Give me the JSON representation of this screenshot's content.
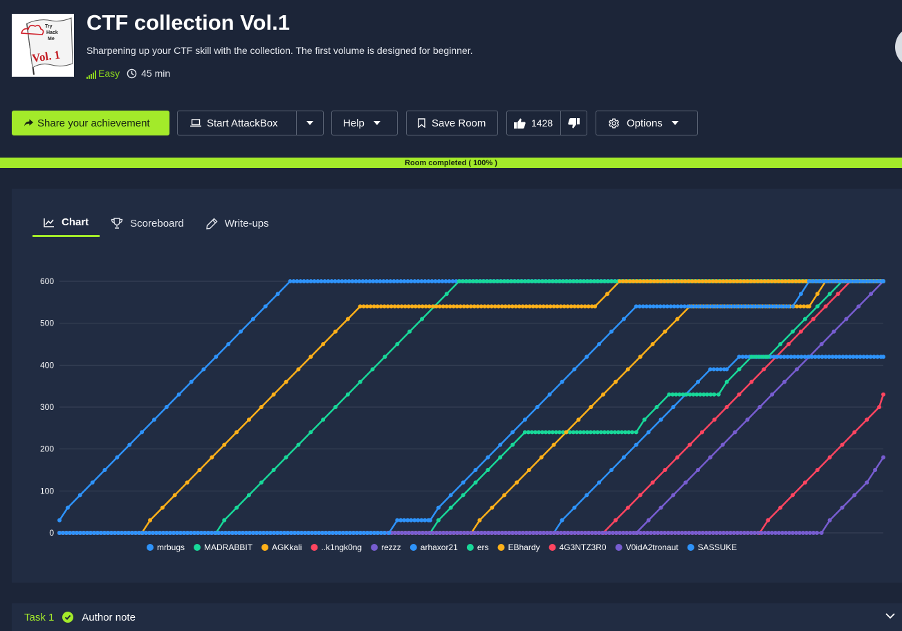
{
  "room": {
    "title": "CTF collection Vol.1",
    "description": "Sharpening up your CTF skill with the collection. The first volume is designed for beginner.",
    "difficulty": "Easy",
    "duration": "45 min",
    "thumbnail": {
      "brand_text_1": "Try",
      "brand_text_2": "Hack",
      "brand_text_3": "Me",
      "vol_text": "Vol. 1"
    }
  },
  "toolbar": {
    "share_label": "Share your achievement",
    "attackbox_label": "Start AttackBox",
    "help_label": "Help",
    "save_label": "Save Room",
    "upvotes": "1428",
    "options_label": "Options"
  },
  "progress": {
    "label": "Room completed ( 100% )",
    "value": 1.0
  },
  "tabs": [
    {
      "label": "Chart",
      "active": true,
      "icon": "chart-line-icon"
    },
    {
      "label": "Scoreboard",
      "active": false,
      "icon": "trophy-icon"
    },
    {
      "label": "Write-ups",
      "active": false,
      "icon": "pencil-icon"
    }
  ],
  "task": {
    "number": "Task 1",
    "title": "Author note"
  },
  "colors": {
    "accent": "#a3ea2a",
    "easy": "#8bd41e",
    "background": "#1c2538",
    "panel": "#212c42"
  },
  "chart_data": {
    "type": "line",
    "title": "",
    "xlabel": "",
    "ylabel": "",
    "ylim": [
      0,
      600
    ],
    "yticks": [
      0,
      100,
      200,
      300,
      400,
      500,
      600
    ],
    "xlim": [
      0,
      200
    ],
    "grid": true,
    "legend_position": "bottom",
    "series": [
      {
        "name": "mrbugs",
        "color": "#2e93fa",
        "points": [
          [
            0,
            30
          ],
          [
            2,
            60
          ],
          [
            5,
            90
          ],
          [
            8,
            120
          ],
          [
            11,
            150
          ],
          [
            14,
            180
          ],
          [
            17,
            210
          ],
          [
            20,
            240
          ],
          [
            23,
            270
          ],
          [
            26,
            300
          ],
          [
            29,
            330
          ],
          [
            32,
            360
          ],
          [
            35,
            390
          ],
          [
            38,
            420
          ],
          [
            41,
            450
          ],
          [
            44,
            480
          ],
          [
            47,
            510
          ],
          [
            50,
            540
          ],
          [
            53,
            570
          ],
          [
            56,
            600
          ],
          [
            200,
            600
          ]
        ]
      },
      {
        "name": "MADRABBIT",
        "color": "#18d899",
        "points": [
          [
            0,
            0
          ],
          [
            38,
            0
          ],
          [
            40,
            30
          ],
          [
            43,
            60
          ],
          [
            46,
            90
          ],
          [
            49,
            120
          ],
          [
            52,
            150
          ],
          [
            55,
            180
          ],
          [
            58,
            210
          ],
          [
            61,
            240
          ],
          [
            64,
            270
          ],
          [
            67,
            300
          ],
          [
            70,
            330
          ],
          [
            73,
            360
          ],
          [
            76,
            390
          ],
          [
            79,
            420
          ],
          [
            82,
            450
          ],
          [
            85,
            480
          ],
          [
            88,
            510
          ],
          [
            91,
            540
          ],
          [
            94,
            570
          ],
          [
            97,
            600
          ],
          [
            200,
            600
          ]
        ]
      },
      {
        "name": "AGKkali",
        "color": "#feb019",
        "points": [
          [
            0,
            0
          ],
          [
            20,
            0
          ],
          [
            22,
            30
          ],
          [
            25,
            60
          ],
          [
            28,
            90
          ],
          [
            31,
            120
          ],
          [
            34,
            150
          ],
          [
            37,
            180
          ],
          [
            40,
            210
          ],
          [
            43,
            240
          ],
          [
            46,
            270
          ],
          [
            49,
            300
          ],
          [
            52,
            330
          ],
          [
            55,
            360
          ],
          [
            58,
            390
          ],
          [
            61,
            420
          ],
          [
            64,
            450
          ],
          [
            67,
            480
          ],
          [
            70,
            510
          ],
          [
            73,
            540
          ],
          [
            130,
            540
          ],
          [
            133,
            570
          ],
          [
            136,
            600
          ],
          [
            200,
            600
          ]
        ]
      },
      {
        "name": "..k1ngk0ng",
        "color": "#ff4560",
        "points": [
          [
            0,
            0
          ],
          [
            132,
            0
          ],
          [
            135,
            30
          ],
          [
            138,
            60
          ],
          [
            141,
            90
          ],
          [
            144,
            120
          ],
          [
            147,
            150
          ],
          [
            150,
            180
          ],
          [
            153,
            210
          ],
          [
            156,
            240
          ],
          [
            159,
            270
          ],
          [
            162,
            300
          ],
          [
            165,
            330
          ],
          [
            168,
            360
          ],
          [
            171,
            390
          ],
          [
            174,
            420
          ],
          [
            177,
            450
          ],
          [
            180,
            480
          ],
          [
            183,
            510
          ],
          [
            186,
            540
          ],
          [
            189,
            570
          ],
          [
            192,
            600
          ],
          [
            200,
            600
          ]
        ]
      },
      {
        "name": "rezzz",
        "color": "#775dd0",
        "points": [
          [
            0,
            0
          ],
          [
            140,
            0
          ],
          [
            143,
            30
          ],
          [
            146,
            60
          ],
          [
            149,
            90
          ],
          [
            152,
            120
          ],
          [
            155,
            150
          ],
          [
            158,
            180
          ],
          [
            161,
            210
          ],
          [
            164,
            240
          ],
          [
            167,
            270
          ],
          [
            170,
            300
          ],
          [
            173,
            330
          ],
          [
            176,
            360
          ],
          [
            179,
            390
          ],
          [
            182,
            420
          ],
          [
            185,
            450
          ],
          [
            188,
            480
          ],
          [
            191,
            510
          ],
          [
            194,
            540
          ],
          [
            197,
            570
          ],
          [
            200,
            600
          ]
        ]
      },
      {
        "name": "arhaxor21",
        "color": "#2e93fa",
        "points": [
          [
            0,
            0
          ],
          [
            120,
            0
          ],
          [
            122,
            30
          ],
          [
            125,
            60
          ],
          [
            128,
            90
          ],
          [
            131,
            120
          ],
          [
            134,
            150
          ],
          [
            137,
            180
          ],
          [
            140,
            210
          ],
          [
            143,
            240
          ],
          [
            146,
            270
          ],
          [
            149,
            300
          ],
          [
            152,
            330
          ],
          [
            155,
            360
          ],
          [
            158,
            390
          ],
          [
            162,
            390
          ],
          [
            165,
            420
          ],
          [
            200,
            420
          ]
        ]
      },
      {
        "name": "ers",
        "color": "#18d899",
        "points": [
          [
            0,
            0
          ],
          [
            90,
            0
          ],
          [
            92,
            30
          ],
          [
            95,
            60
          ],
          [
            98,
            90
          ],
          [
            101,
            120
          ],
          [
            104,
            150
          ],
          [
            107,
            180
          ],
          [
            110,
            210
          ],
          [
            113,
            240
          ],
          [
            140,
            240
          ],
          [
            142,
            270
          ],
          [
            145,
            300
          ],
          [
            148,
            330
          ],
          [
            160,
            330
          ],
          [
            162,
            360
          ],
          [
            165,
            390
          ],
          [
            168,
            420
          ],
          [
            172,
            420
          ],
          [
            175,
            450
          ],
          [
            178,
            480
          ],
          [
            181,
            510
          ],
          [
            184,
            540
          ],
          [
            187,
            570
          ],
          [
            190,
            600
          ],
          [
            200,
            600
          ]
        ]
      },
      {
        "name": "EBhardy",
        "color": "#feb019",
        "points": [
          [
            0,
            0
          ],
          [
            100,
            0
          ],
          [
            102,
            30
          ],
          [
            105,
            60
          ],
          [
            108,
            90
          ],
          [
            111,
            120
          ],
          [
            114,
            150
          ],
          [
            117,
            180
          ],
          [
            120,
            210
          ],
          [
            123,
            240
          ],
          [
            126,
            270
          ],
          [
            129,
            300
          ],
          [
            132,
            330
          ],
          [
            135,
            360
          ],
          [
            138,
            390
          ],
          [
            141,
            420
          ],
          [
            144,
            450
          ],
          [
            147,
            480
          ],
          [
            150,
            510
          ],
          [
            153,
            540
          ],
          [
            182,
            540
          ],
          [
            184,
            570
          ],
          [
            186,
            600
          ],
          [
            200,
            600
          ]
        ]
      },
      {
        "name": "4G3NTZ3R0",
        "color": "#ff4560",
        "points": [
          [
            0,
            0
          ],
          [
            170,
            0
          ],
          [
            172,
            30
          ],
          [
            175,
            60
          ],
          [
            178,
            90
          ],
          [
            181,
            120
          ],
          [
            184,
            150
          ],
          [
            187,
            180
          ],
          [
            190,
            210
          ],
          [
            193,
            240
          ],
          [
            196,
            270
          ],
          [
            199,
            300
          ],
          [
            200,
            330
          ]
        ]
      },
      {
        "name": "V0idA2tronaut",
        "color": "#775dd0",
        "points": [
          [
            0,
            0
          ],
          [
            185,
            0
          ],
          [
            187,
            30
          ],
          [
            190,
            60
          ],
          [
            193,
            90
          ],
          [
            196,
            120
          ],
          [
            198,
            150
          ],
          [
            200,
            180
          ]
        ]
      },
      {
        "name": "SASSUKE",
        "color": "#2e93fa",
        "points": [
          [
            0,
            0
          ],
          [
            80,
            0
          ],
          [
            82,
            30
          ],
          [
            90,
            30
          ],
          [
            92,
            60
          ],
          [
            95,
            90
          ],
          [
            98,
            120
          ],
          [
            101,
            150
          ],
          [
            104,
            180
          ],
          [
            107,
            210
          ],
          [
            110,
            240
          ],
          [
            113,
            270
          ],
          [
            116,
            300
          ],
          [
            119,
            330
          ],
          [
            122,
            360
          ],
          [
            125,
            390
          ],
          [
            128,
            420
          ],
          [
            131,
            450
          ],
          [
            134,
            480
          ],
          [
            137,
            510
          ],
          [
            140,
            540
          ],
          [
            178,
            540
          ],
          [
            180,
            570
          ],
          [
            182,
            600
          ],
          [
            200,
            600
          ]
        ]
      }
    ]
  }
}
